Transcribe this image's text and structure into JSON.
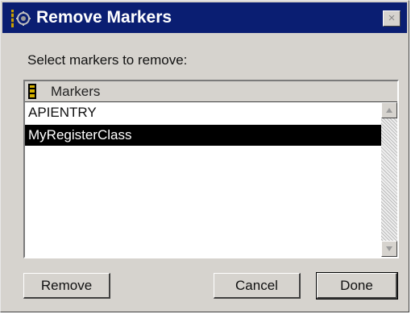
{
  "window": {
    "title": "Remove Markers",
    "icon": "markers-icon",
    "close_label": "×"
  },
  "prompt": "Select markers to remove:",
  "list": {
    "header_icon": "marker-header-icon",
    "header_label": "Markers",
    "items": [
      {
        "label": "APIENTRY",
        "selected": false
      },
      {
        "label": "MyRegisterClass",
        "selected": true
      }
    ]
  },
  "buttons": {
    "remove_label": "Remove",
    "cancel_label": "Cancel",
    "done_label": "Done"
  },
  "colors": {
    "titlebar": "#0a1e72",
    "dialog_face": "#d6d3ce",
    "selection": "#000000"
  }
}
